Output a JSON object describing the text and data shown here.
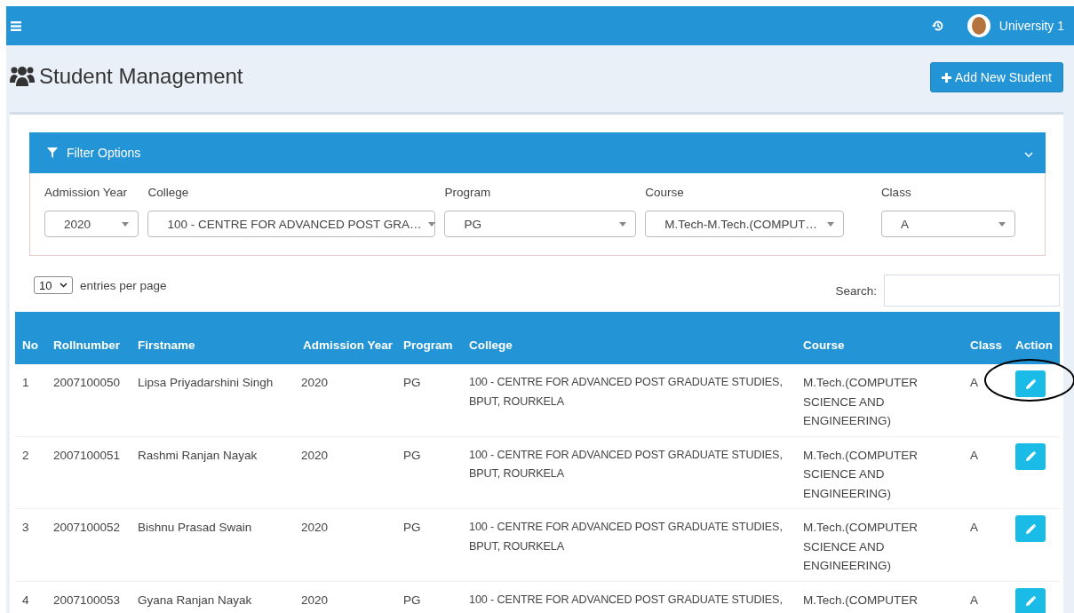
{
  "topbar": {
    "user_name": "University 1"
  },
  "page": {
    "title": "Student Management",
    "add_button": "Add New Student"
  },
  "filter": {
    "title": "Filter Options",
    "expanded": true,
    "fields": [
      {
        "label": "Admission Year",
        "value": "2020"
      },
      {
        "label": "College",
        "value": "100 - CENTRE FOR ADVANCED POST GRA…"
      },
      {
        "label": "Program",
        "value": "PG"
      },
      {
        "label": "Course",
        "value": "M.Tech-M.Tech.(COMPUT…"
      },
      {
        "label": "Class",
        "value": "A"
      }
    ]
  },
  "table_controls": {
    "page_size": "10",
    "page_size_label": "entries per page",
    "search_label": "Search:"
  },
  "table": {
    "columns": [
      "No",
      "Rollnumber",
      "Firstname",
      "Admission Year",
      "Program",
      "College",
      "Course",
      "Class",
      "Action"
    ],
    "rows": [
      {
        "cells": [
          "1",
          "2007100050",
          "Lipsa Priyadarshini Singh",
          "2020",
          "PG",
          "100 - CENTRE FOR ADVANCED POST GRADUATE STUDIES, BPUT, ROURKELA",
          "M.Tech.(COMPUTER SCIENCE AND ENGINEERING)",
          "A"
        ],
        "circled": true
      },
      {
        "cells": [
          "2",
          "2007100051",
          "Rashmi Ranjan Nayak",
          "2020",
          "PG",
          "100 - CENTRE FOR ADVANCED POST GRADUATE STUDIES, BPUT, ROURKELA",
          "M.Tech.(COMPUTER SCIENCE AND ENGINEERING)",
          "A"
        ],
        "circled": false
      },
      {
        "cells": [
          "3",
          "2007100052",
          "Bishnu Prasad Swain",
          "2020",
          "PG",
          "100 - CENTRE FOR ADVANCED POST GRADUATE STUDIES, BPUT, ROURKELA",
          "M.Tech.(COMPUTER SCIENCE AND ENGINEERING)",
          "A"
        ],
        "circled": false
      },
      {
        "cells": [
          "4",
          "2007100053",
          "Gyana Ranjan Nayak",
          "2020",
          "PG",
          "100 - CENTRE FOR ADVANCED POST GRADUATE STUDIES,",
          "M.Tech.(COMPUTER",
          "A"
        ],
        "circled": false
      }
    ]
  }
}
